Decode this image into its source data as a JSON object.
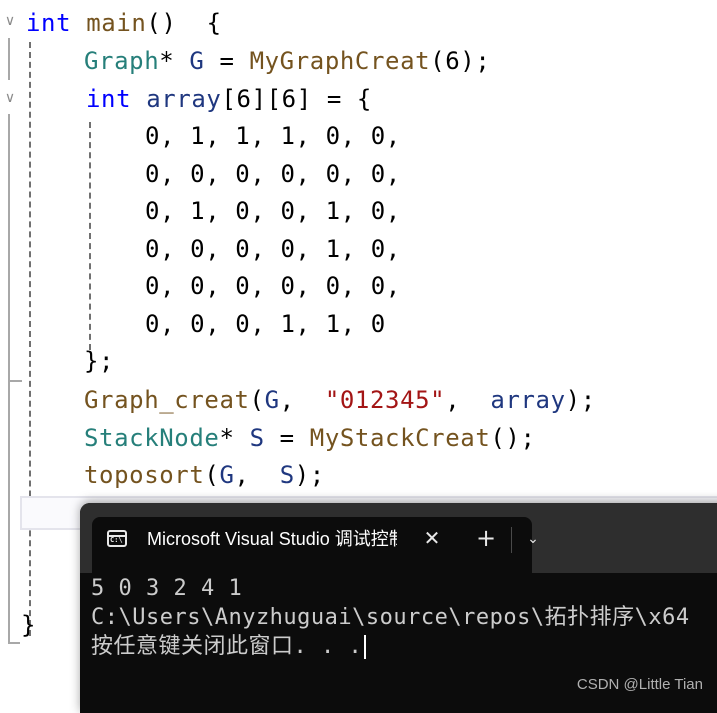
{
  "editor": {
    "lines": [
      {
        "tokens": [
          {
            "t": "int",
            "c": "kw"
          },
          {
            "t": " ",
            "c": "punct"
          },
          {
            "t": "main",
            "c": "fn"
          },
          {
            "t": "()  {",
            "c": "punct"
          }
        ]
      },
      {
        "tokens": [
          {
            "t": "Graph",
            "c": "type"
          },
          {
            "t": "* ",
            "c": "punct"
          },
          {
            "t": "G",
            "c": "var"
          },
          {
            "t": " = ",
            "c": "punct"
          },
          {
            "t": "MyGraphCreat",
            "c": "fn"
          },
          {
            "t": "(6);",
            "c": "punct"
          }
        ]
      },
      {
        "tokens": [
          {
            "t": "int",
            "c": "kw"
          },
          {
            "t": " ",
            "c": "punct"
          },
          {
            "t": "array",
            "c": "var"
          },
          {
            "t": "[6][6] = {",
            "c": "punct"
          }
        ]
      },
      {
        "tokens": [
          {
            "t": "0, 1, 1, 1, 0, 0,",
            "c": "num"
          }
        ]
      },
      {
        "tokens": [
          {
            "t": "0, 0, 0, 0, 0, 0,",
            "c": "num"
          }
        ]
      },
      {
        "tokens": [
          {
            "t": "0, 1, 0, 0, 1, 0,",
            "c": "num"
          }
        ]
      },
      {
        "tokens": [
          {
            "t": "0, 0, 0, 0, 1, 0,",
            "c": "num"
          }
        ]
      },
      {
        "tokens": [
          {
            "t": "0, 0, 0, 0, 0, 0,",
            "c": "num"
          }
        ]
      },
      {
        "tokens": [
          {
            "t": "0, 0, 0, 1, 1, 0",
            "c": "num"
          }
        ]
      },
      {
        "tokens": [
          {
            "t": "};",
            "c": "punct"
          }
        ]
      },
      {
        "tokens": [
          {
            "t": "Graph_creat",
            "c": "fn"
          },
          {
            "t": "(",
            "c": "punct"
          },
          {
            "t": "G",
            "c": "var"
          },
          {
            "t": ",  ",
            "c": "punct"
          },
          {
            "t": "\"012345\"",
            "c": "str"
          },
          {
            "t": ",  ",
            "c": "punct"
          },
          {
            "t": "array",
            "c": "var"
          },
          {
            "t": ");",
            "c": "punct"
          }
        ]
      },
      {
        "tokens": [
          {
            "t": "StackNode",
            "c": "type"
          },
          {
            "t": "* ",
            "c": "punct"
          },
          {
            "t": "S",
            "c": "var"
          },
          {
            "t": " = ",
            "c": "punct"
          },
          {
            "t": "MyStackCreat",
            "c": "fn"
          },
          {
            "t": "();",
            "c": "punct"
          }
        ]
      },
      {
        "tokens": [
          {
            "t": "toposort",
            "c": "fn"
          },
          {
            "t": "(",
            "c": "punct"
          },
          {
            "t": "G",
            "c": "var"
          },
          {
            "t": ",  ",
            "c": "punct"
          },
          {
            "t": "S",
            "c": "var"
          },
          {
            "t": ");",
            "c": "punct"
          }
        ]
      },
      {
        "tokens": [
          {
            "t": "}",
            "c": "punct"
          }
        ]
      }
    ],
    "fold_icon": "chevron-down-icon"
  },
  "console": {
    "tab_title": "Microsoft Visual Studio 调试控制台",
    "tab_icon": "terminal-icon",
    "tab_icon_text": "C:\\",
    "close_glyph": "✕",
    "new_tab_glyph": "+",
    "dropdown_glyph": "⌄",
    "output": [
      "5 0 3 2 4 1",
      "C:\\Users\\Anyzhuguai\\source\\repos\\拓扑排序\\x64",
      "按任意键关闭此窗口. . ."
    ]
  },
  "watermark": "CSDN @Little Tian"
}
